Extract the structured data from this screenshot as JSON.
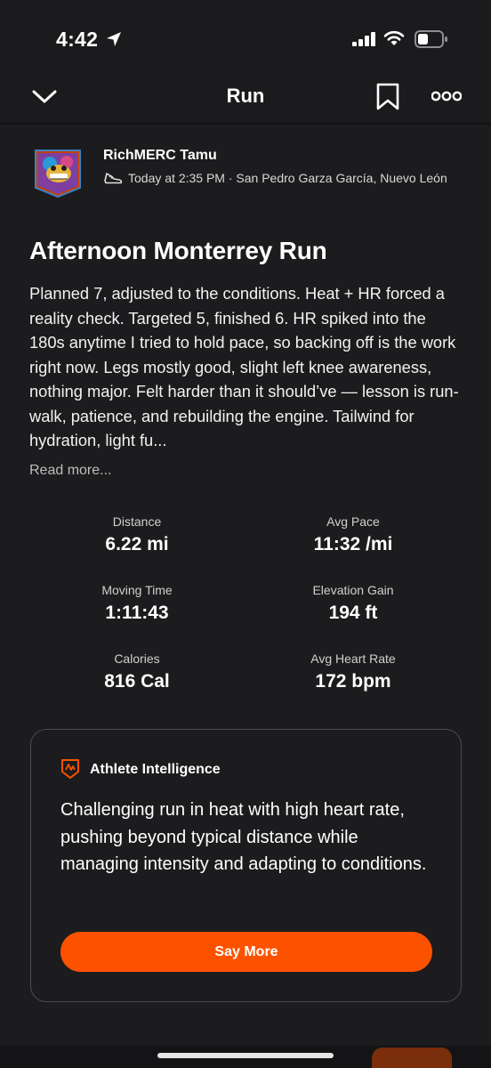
{
  "status_bar": {
    "time": "4:42",
    "icons": [
      "location-arrow-icon",
      "signal-icon",
      "wifi-icon",
      "battery-icon"
    ]
  },
  "nav": {
    "title": "Run",
    "icons": [
      "chevron-down-icon",
      "bookmark-icon",
      "more-icon"
    ]
  },
  "header": {
    "athlete_name": "RichMERC Tamu",
    "meta": "Today at 2:35 PM · San Pedro Garza García, Nuevo León"
  },
  "activity": {
    "title": "Afternoon Monterrey Run",
    "description": "Planned 7, adjusted to the conditions. Heat + HR forced a reality check. Targeted 5, finished 6. HR spiked into the 180s anytime I tried to hold pace, so backing off is the work right now. Legs mostly good, slight left knee awareness, nothing major. Felt harder than it should’ve — lesson is run-walk, patience, and rebuilding the engine. Tailwind for hydration, light fu...",
    "read_more": "Read more..."
  },
  "stats": [
    {
      "label": "Distance",
      "value": "6.22 mi"
    },
    {
      "label": "Avg Pace",
      "value": "11:32 /mi"
    },
    {
      "label": "Moving Time",
      "value": "1:11:43"
    },
    {
      "label": "Elevation Gain",
      "value": "194 ft"
    },
    {
      "label": "Calories",
      "value": "816 Cal"
    },
    {
      "label": "Avg Heart Rate",
      "value": "172 bpm"
    }
  ],
  "ai_card": {
    "title": "Athlete Intelligence",
    "summary": "Challenging run in heat with high heart rate, pushing beyond typical distance while managing intensity and adapting to conditions.",
    "button_label": "Say More"
  },
  "colors": {
    "background": "#1c1c1e",
    "accent": "#fc5200",
    "card_border": "#4a4a4c"
  }
}
